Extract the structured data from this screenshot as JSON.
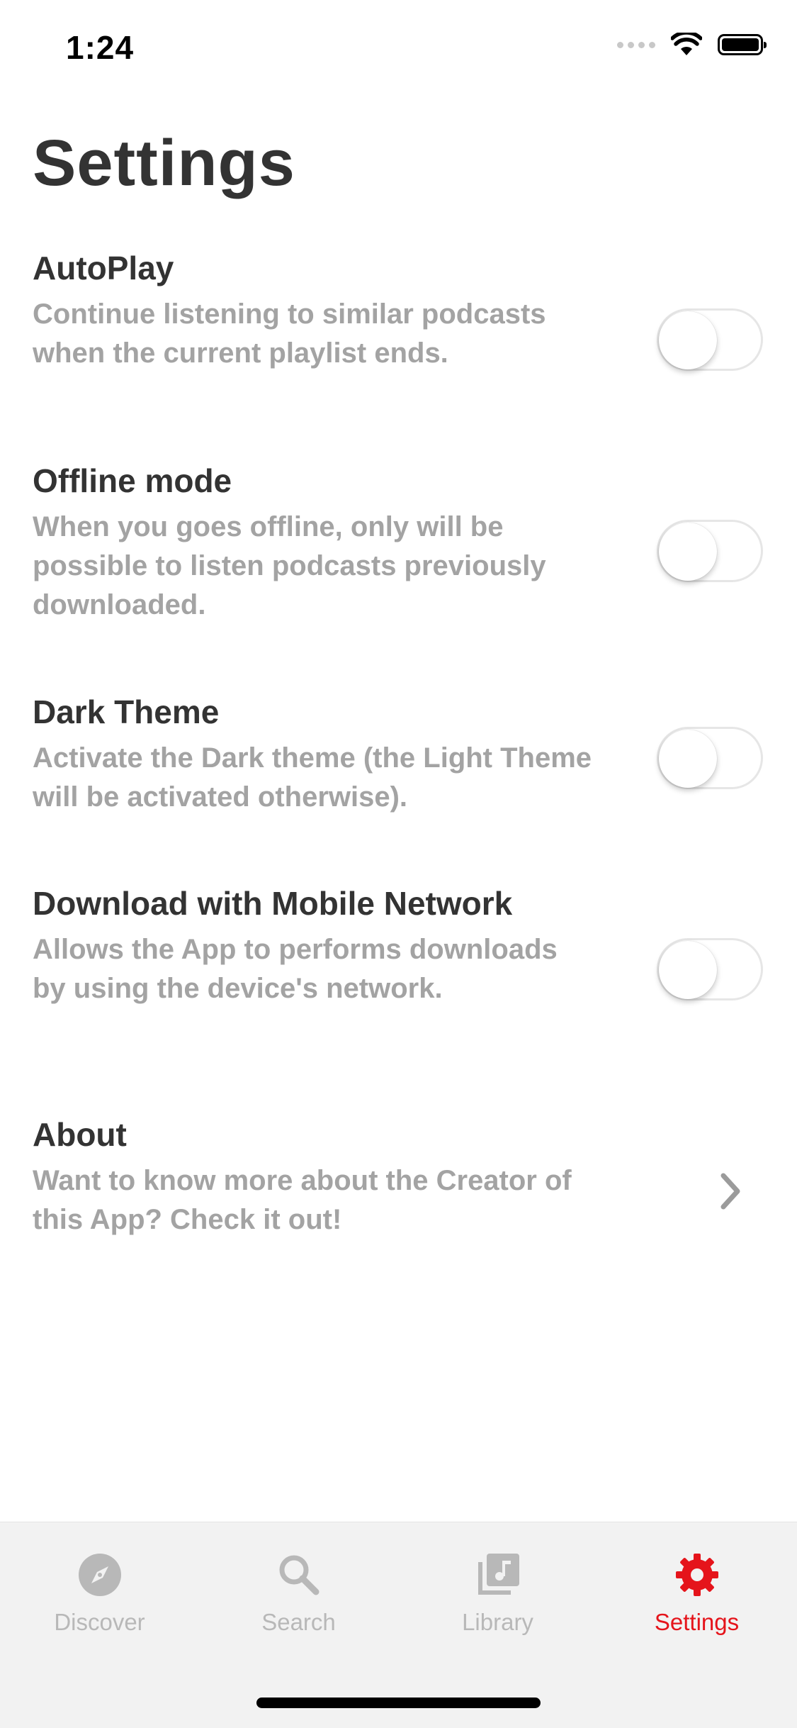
{
  "status_bar": {
    "time": "1:24"
  },
  "page": {
    "title": "Settings"
  },
  "settings": [
    {
      "title": "AutoPlay",
      "description": "Continue listening to similar podcasts when the current playlist ends.",
      "control": "toggle",
      "enabled": false
    },
    {
      "title": "Offline mode",
      "description": "When you goes offline, only will be possible to listen podcasts previously downloaded.",
      "control": "toggle",
      "enabled": false
    },
    {
      "title": "Dark Theme",
      "description": "Activate the Dark theme (the Light Theme will be activated otherwise).",
      "control": "toggle",
      "enabled": false
    },
    {
      "title": "Download with Mobile Network",
      "description": "Allows the App to performs downloads by using the device's network.",
      "control": "toggle",
      "enabled": false
    },
    {
      "title": "About",
      "description": "Want to know more about the Creator of this App? Check it out!",
      "control": "chevron-right-icon"
    }
  ],
  "tab_bar": {
    "items": [
      {
        "label": "Discover",
        "icon": "compass-icon",
        "active": false
      },
      {
        "label": "Search",
        "icon": "search-icon",
        "active": false
      },
      {
        "label": "Library",
        "icon": "library-icon",
        "active": false
      },
      {
        "label": "Settings",
        "icon": "gear-icon",
        "active": true
      }
    ]
  },
  "colors": {
    "accent": "#e5141b",
    "title_text": "#333333",
    "secondary_text": "#a3a3a3",
    "inactive_tab": "#b8b8b8",
    "tab_bar_background": "#f2f2f2"
  }
}
